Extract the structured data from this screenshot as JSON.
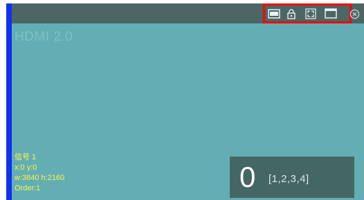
{
  "window": {
    "source_label": "HDMI 2.0"
  },
  "toolbar": {
    "icons": [
      "abc-icon",
      "lock-icon",
      "fullscreen-icon",
      "window-icon"
    ],
    "close_icon": "close-icon"
  },
  "info": {
    "signal_line": "信号 1",
    "coords": "x:0  y:0",
    "size": "w:3840  h:2160",
    "order": "Order:1"
  },
  "order_panel": {
    "number": "0",
    "list": "[1,2,3,4]"
  },
  "colors": {
    "background": "#62aeb4",
    "titlebar": "#4c6664",
    "left_edge": "#1231ee",
    "highlight": "#ff0000",
    "info_text": "#fff44a",
    "panel": "#456764"
  }
}
